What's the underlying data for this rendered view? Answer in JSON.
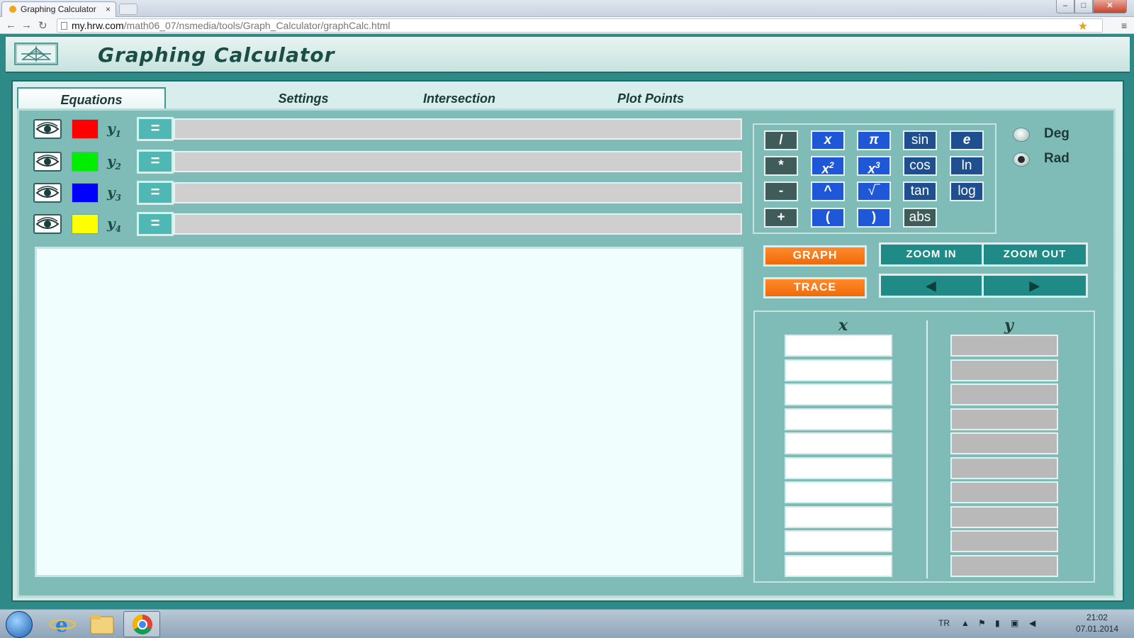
{
  "browser": {
    "tab_title": "Graphing Calculator",
    "tab_close": "×",
    "url_host": "my.hrw.com",
    "url_path": "/math06_07/nsmedia/tools/Graph_Calculator/graphCalc.html",
    "star": "★",
    "menu": "≡"
  },
  "app": {
    "title": "Graphing Calculator",
    "tabs": [
      {
        "label": "Equations"
      },
      {
        "label": "Settings"
      },
      {
        "label": "Intersection"
      },
      {
        "label": "Plot Points"
      }
    ],
    "equations": [
      {
        "label": "y",
        "sub": "1",
        "color": "#ff0000",
        "eq_symbol": "=",
        "value": ""
      },
      {
        "label": "y",
        "sub": "2",
        "color": "#00ee00",
        "eq_symbol": "=",
        "value": ""
      },
      {
        "label": "y",
        "sub": "3",
        "color": "#0000ff",
        "eq_symbol": "=",
        "value": ""
      },
      {
        "label": "y",
        "sub": "4",
        "color": "#ffff00",
        "eq_symbol": "=",
        "value": ""
      }
    ],
    "keypad": {
      "divide": "/",
      "x": "x",
      "pi": "π",
      "sin": "sin",
      "e": "e",
      "multiply": "*",
      "x2": "x",
      "x3": "x",
      "cos": "cos",
      "ln": "ln",
      "minus": "-",
      "caret": "^",
      "sqrt": "√‾",
      "tan": "tan",
      "log": "log",
      "plus": "+",
      "lparen": "(",
      "rparen": ")",
      "abs": "abs",
      "sup2": "2",
      "sup3": "3"
    },
    "angle_mode": {
      "deg": "Deg",
      "rad": "Rad",
      "selected": "Rad"
    },
    "buttons": {
      "graph": "GRAPH",
      "trace": "TRACE",
      "zoom_in": "ZOOM IN",
      "zoom_out": "ZOOM OUT",
      "left": "◀",
      "right": "▶"
    },
    "table": {
      "x_header": "x",
      "y_header": "y",
      "x_values": [
        "",
        "",
        "",
        "",
        "",
        "",
        "",
        "",
        "",
        ""
      ],
      "y_values": [
        "",
        "",
        "",
        "",
        "",
        "",
        "",
        "",
        "",
        ""
      ]
    }
  },
  "taskbar": {
    "lang": "TR",
    "time": "21:02",
    "date": "07.01.2014"
  }
}
